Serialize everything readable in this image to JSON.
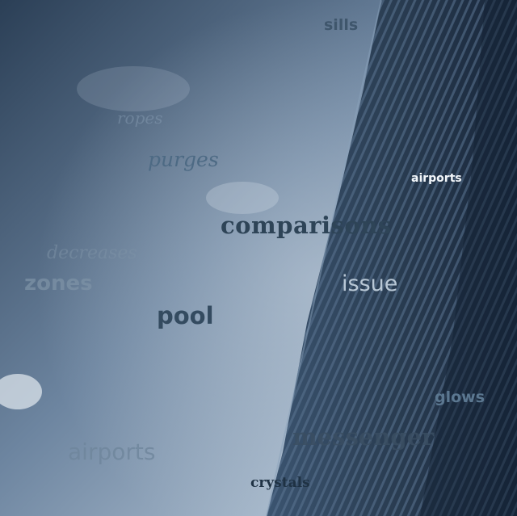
{
  "scene": {
    "description_colors": {
      "sky_light": "#9db0c5",
      "sky_dark": "#2c4058",
      "building": "#1f2e40",
      "building_stripe": "#3f5a76"
    }
  },
  "words": {
    "sills": "sills",
    "ropes": "ropes",
    "purges": "purges",
    "airports_top": "airports",
    "comparisons": "comparisons",
    "decreases": "decreases",
    "zones": "zones",
    "issue": "issue",
    "pool": "pool",
    "glows": "glows",
    "messenger": "messenger",
    "airports_bottom": "airports",
    "crystals": "crystals"
  }
}
